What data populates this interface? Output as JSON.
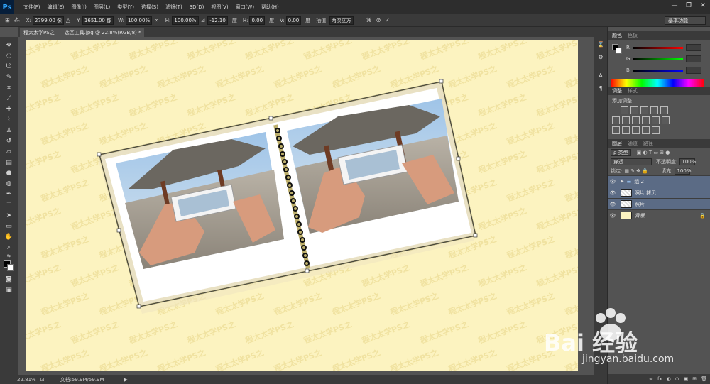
{
  "app": {
    "logo": "Ps"
  },
  "menu": [
    "文件(F)",
    "编辑(E)",
    "图像(I)",
    "图层(L)",
    "类型(Y)",
    "选择(S)",
    "滤镜(T)",
    "3D(D)",
    "视图(V)",
    "窗口(W)",
    "帮助(H)"
  ],
  "window_controls": [
    "—",
    "❐",
    "✕"
  ],
  "options": {
    "x_label": "X:",
    "x_value": "2799.00 像",
    "y_label": "Y:",
    "y_value": "1651.00 像",
    "w_label": "W:",
    "w_value": "100.00%",
    "h_label": "H:",
    "h_value": "100.00%",
    "angle_value": "-12.10",
    "angle_unit": "度",
    "hskew_label": "H:",
    "hskew_value": "0.00",
    "vskew_label": "V:",
    "vskew_value": "0.00",
    "skew_unit": "度",
    "interp_label": "插值:",
    "interp_value": "两次立方",
    "workspace": "基本功能"
  },
  "document": {
    "tab_title": "程太太学PS之——选区工具.jpg @ 22.8%(RGB/8) *"
  },
  "status": {
    "zoom": "22.81%",
    "doc_size": "文档:59.9M/59.9M"
  },
  "canvas": {
    "watermark_text": "程太太学PS之",
    "background_color": "#fcf3c0"
  },
  "panels": {
    "color_tabs": [
      "颜色",
      "色板"
    ],
    "color_channels": [
      "R",
      "G",
      "B"
    ],
    "adjust_tabs": [
      "调整",
      "样式"
    ],
    "adjust_title": "添加调整",
    "layers_tabs": [
      "图层",
      "通道",
      "路径"
    ],
    "filter_type": "ρ 类型",
    "blend_mode": "穿透",
    "opacity_label": "不透明度:",
    "opacity_value": "100%",
    "lock_label": "锁定:",
    "fill_label": "填充:",
    "fill_value": "100%",
    "layers": [
      {
        "name": "组 2",
        "selected": true,
        "type": "group"
      },
      {
        "name": "照片 拷贝",
        "selected": true,
        "type": "image"
      },
      {
        "name": "照片",
        "selected": true,
        "type": "image"
      },
      {
        "name": "背景",
        "selected": false,
        "type": "background"
      }
    ],
    "layer_footer_icons": [
      "∞",
      "fx",
      "◐",
      "⊙",
      "▣",
      "⊞",
      "🗑"
    ]
  },
  "watermark": {
    "brand": "Bai 经验",
    "url": "jingyan.baidu.com"
  },
  "colors": {
    "ui_dark": "#2d2d2d",
    "ui_mid": "#3a3a3a",
    "ui_bg": "#535353",
    "selection": "#5b6b85",
    "ps_blue": "#31a8ff"
  }
}
